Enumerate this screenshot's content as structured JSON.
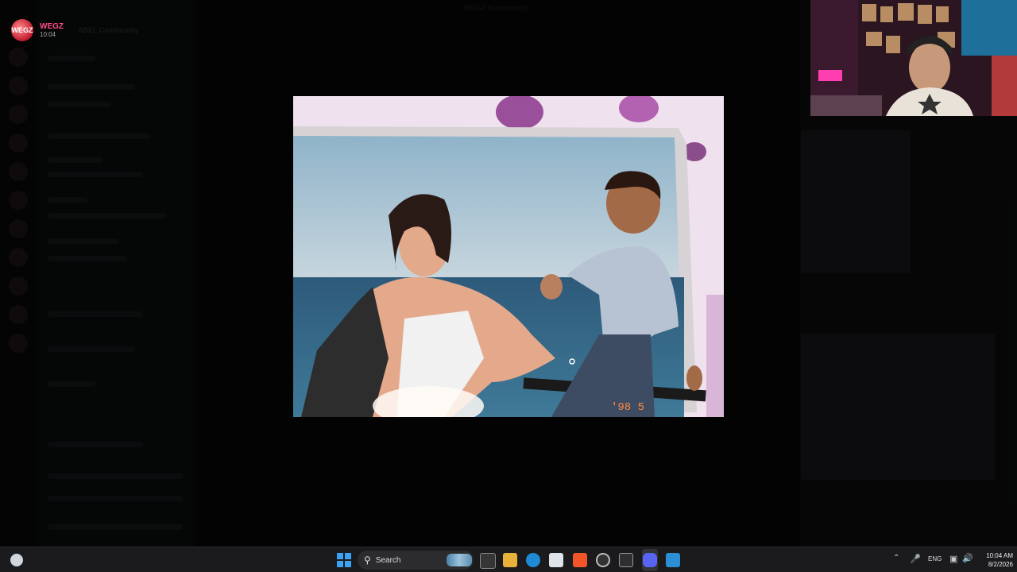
{
  "notification": {
    "name": "WEGZ",
    "time": "10:04",
    "avatar_label": "WEGZ"
  },
  "background": {
    "server_title": "ADEL Community",
    "window_title": "WEGZ (Community)"
  },
  "viewer": {
    "photo_description_icon": "photo",
    "date_stamp": "'98 5"
  },
  "webcam": {
    "icon": "webcam-feed"
  },
  "taskbar": {
    "search_label": "Search",
    "language": "ENG",
    "time": "10:04 AM",
    "date": "8/2/2026",
    "apps": [
      "task-view",
      "file-explorer",
      "edge",
      "store",
      "brave",
      "chrome",
      "network-app",
      "discord",
      "app"
    ]
  },
  "colors": {
    "accent": "#ff4d8a",
    "taskbar": "#1b1b1d",
    "start": "#3aa3f5"
  }
}
